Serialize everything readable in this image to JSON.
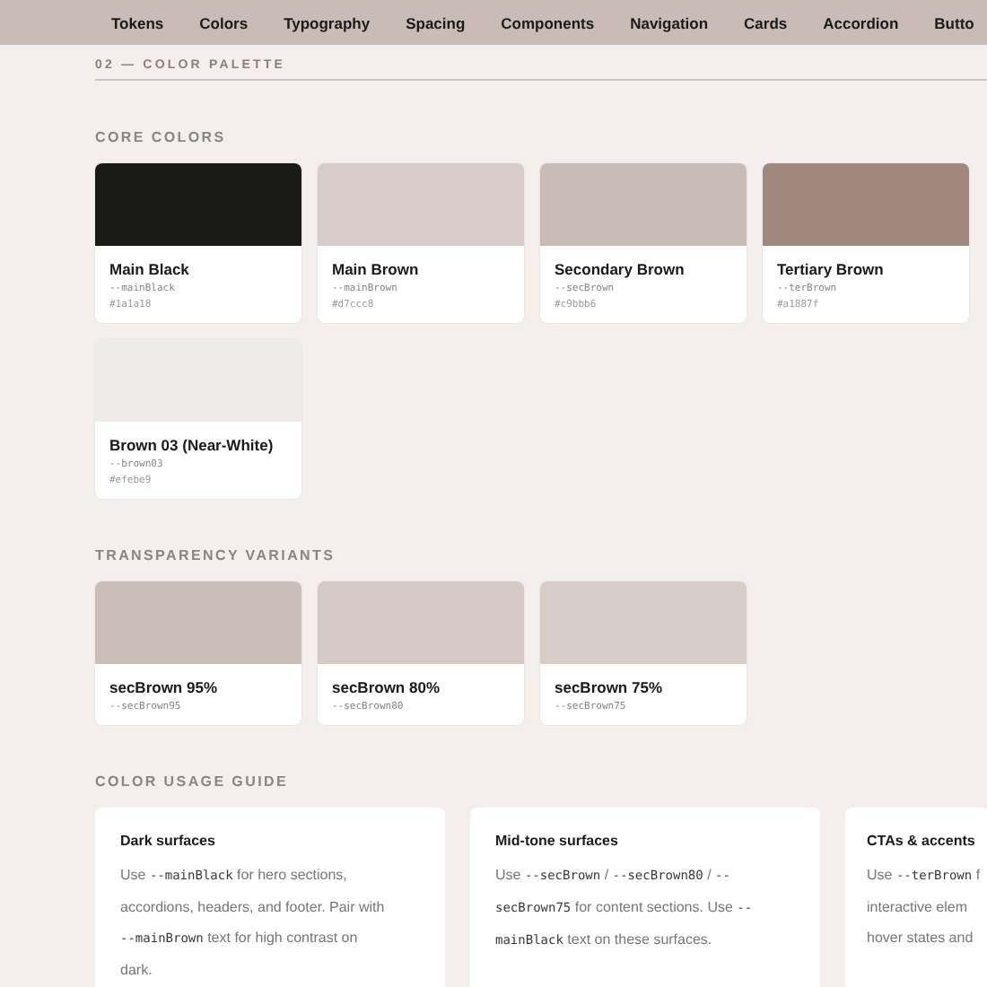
{
  "nav": [
    "Tokens",
    "Colors",
    "Typography",
    "Spacing",
    "Components",
    "Navigation",
    "Cards",
    "Accordion",
    "Butto"
  ],
  "section_label": "02 — COLOR PALETTE",
  "core_colors": {
    "heading": "CORE COLORS",
    "swatches": [
      {
        "name": "Main Black",
        "token": "--mainBlack",
        "hex": "#1a1a18",
        "color": "#1a1a18"
      },
      {
        "name": "Main Brown",
        "token": "--mainBrown",
        "hex": "#d7ccc8",
        "color": "#d7ccc8"
      },
      {
        "name": "Secondary Brown",
        "token": "--secBrown",
        "hex": "#c9bbb6",
        "color": "#c9bbb6"
      },
      {
        "name": "Tertiary Brown",
        "token": "--terBrown",
        "hex": "#a1887f",
        "color": "#a1887f"
      },
      {
        "name": "Brown 03 (Near-White)",
        "token": "--brown03",
        "hex": "#efebe9",
        "color": "#efebe9"
      }
    ]
  },
  "transparency_variants": {
    "heading": "TRANSPARENCY VARIANTS",
    "swatches": [
      {
        "name": "secBrown 95%",
        "token": "--secBrown95",
        "color": "#cbbdb8"
      },
      {
        "name": "secBrown 80%",
        "token": "--secBrown80",
        "color": "#d4c9c5"
      },
      {
        "name": "secBrown 75%",
        "token": "--secBrown75",
        "color": "#d6ccc8"
      }
    ]
  },
  "usage_guide": {
    "heading": "COLOR USAGE GUIDE",
    "cards": [
      {
        "title": "Dark surfaces",
        "body": [
          [
            {
              "text": "Use ",
              "code": false
            },
            {
              "text": "--mainBlack",
              "code": true
            },
            {
              "text": " for hero sections,",
              "code": false
            }
          ],
          [
            {
              "text": "accordions, headers, and footer. Pair with",
              "code": false
            }
          ],
          [
            {
              "text": "--mainBrown",
              "code": true
            },
            {
              "text": " text for high contrast on",
              "code": false
            }
          ],
          [
            {
              "text": "dark.",
              "code": false
            }
          ]
        ]
      },
      {
        "title": "Mid-tone surfaces",
        "body": [
          [
            {
              "text": "Use ",
              "code": false
            },
            {
              "text": "--secBrown",
              "code": true
            },
            {
              "text": " / ",
              "code": false
            },
            {
              "text": "--secBrown80",
              "code": true
            },
            {
              "text": " / ",
              "code": false
            },
            {
              "text": "--",
              "code": true
            }
          ],
          [
            {
              "text": "secBrown75",
              "code": true
            },
            {
              "text": " for content sections. Use ",
              "code": false
            },
            {
              "text": "--",
              "code": true
            }
          ],
          [
            {
              "text": "mainBlack",
              "code": true
            },
            {
              "text": " text on these surfaces.",
              "code": false
            }
          ]
        ]
      },
      {
        "title": "CTAs & accents",
        "body": [
          [
            {
              "text": "Use ",
              "code": false
            },
            {
              "text": "--terBrown",
              "code": true
            },
            {
              "text": " f",
              "code": false
            }
          ],
          [
            {
              "text": "interactive elem",
              "code": false
            }
          ],
          [
            {
              "text": "hover states and",
              "code": false
            }
          ]
        ]
      }
    ]
  }
}
